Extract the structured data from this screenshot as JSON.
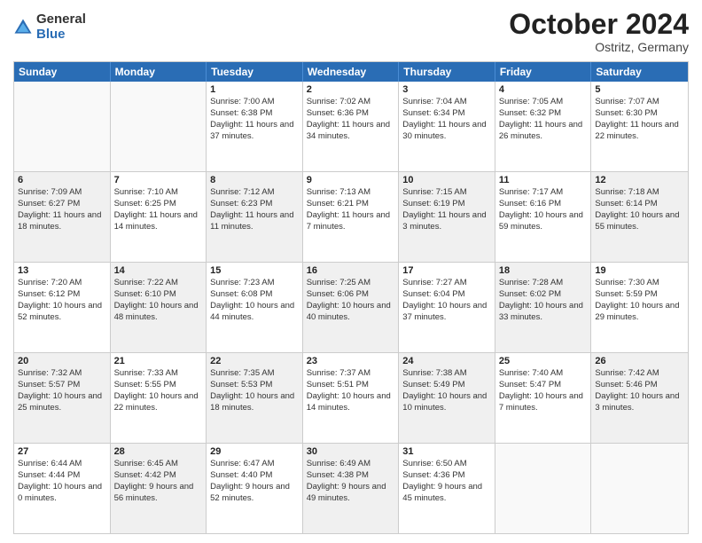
{
  "header": {
    "logo": {
      "general": "General",
      "blue": "Blue"
    },
    "title": "October 2024",
    "location": "Ostritz, Germany"
  },
  "days_of_week": [
    "Sunday",
    "Monday",
    "Tuesday",
    "Wednesday",
    "Thursday",
    "Friday",
    "Saturday"
  ],
  "weeks": [
    [
      {
        "day": "",
        "sunrise": "",
        "sunset": "",
        "daylight": "",
        "empty": true
      },
      {
        "day": "",
        "sunrise": "",
        "sunset": "",
        "daylight": "",
        "empty": true
      },
      {
        "day": "1",
        "sunrise": "Sunrise: 7:00 AM",
        "sunset": "Sunset: 6:38 PM",
        "daylight": "Daylight: 11 hours and 37 minutes.",
        "empty": false
      },
      {
        "day": "2",
        "sunrise": "Sunrise: 7:02 AM",
        "sunset": "Sunset: 6:36 PM",
        "daylight": "Daylight: 11 hours and 34 minutes.",
        "empty": false
      },
      {
        "day": "3",
        "sunrise": "Sunrise: 7:04 AM",
        "sunset": "Sunset: 6:34 PM",
        "daylight": "Daylight: 11 hours and 30 minutes.",
        "empty": false
      },
      {
        "day": "4",
        "sunrise": "Sunrise: 7:05 AM",
        "sunset": "Sunset: 6:32 PM",
        "daylight": "Daylight: 11 hours and 26 minutes.",
        "empty": false
      },
      {
        "day": "5",
        "sunrise": "Sunrise: 7:07 AM",
        "sunset": "Sunset: 6:30 PM",
        "daylight": "Daylight: 11 hours and 22 minutes.",
        "empty": false
      }
    ],
    [
      {
        "day": "6",
        "sunrise": "Sunrise: 7:09 AM",
        "sunset": "Sunset: 6:27 PM",
        "daylight": "Daylight: 11 hours and 18 minutes.",
        "empty": false,
        "shaded": true
      },
      {
        "day": "7",
        "sunrise": "Sunrise: 7:10 AM",
        "sunset": "Sunset: 6:25 PM",
        "daylight": "Daylight: 11 hours and 14 minutes.",
        "empty": false
      },
      {
        "day": "8",
        "sunrise": "Sunrise: 7:12 AM",
        "sunset": "Sunset: 6:23 PM",
        "daylight": "Daylight: 11 hours and 11 minutes.",
        "empty": false,
        "shaded": true
      },
      {
        "day": "9",
        "sunrise": "Sunrise: 7:13 AM",
        "sunset": "Sunset: 6:21 PM",
        "daylight": "Daylight: 11 hours and 7 minutes.",
        "empty": false
      },
      {
        "day": "10",
        "sunrise": "Sunrise: 7:15 AM",
        "sunset": "Sunset: 6:19 PM",
        "daylight": "Daylight: 11 hours and 3 minutes.",
        "empty": false,
        "shaded": true
      },
      {
        "day": "11",
        "sunrise": "Sunrise: 7:17 AM",
        "sunset": "Sunset: 6:16 PM",
        "daylight": "Daylight: 10 hours and 59 minutes.",
        "empty": false
      },
      {
        "day": "12",
        "sunrise": "Sunrise: 7:18 AM",
        "sunset": "Sunset: 6:14 PM",
        "daylight": "Daylight: 10 hours and 55 minutes.",
        "empty": false,
        "shaded": true
      }
    ],
    [
      {
        "day": "13",
        "sunrise": "Sunrise: 7:20 AM",
        "sunset": "Sunset: 6:12 PM",
        "daylight": "Daylight: 10 hours and 52 minutes.",
        "empty": false
      },
      {
        "day": "14",
        "sunrise": "Sunrise: 7:22 AM",
        "sunset": "Sunset: 6:10 PM",
        "daylight": "Daylight: 10 hours and 48 minutes.",
        "empty": false,
        "shaded": true
      },
      {
        "day": "15",
        "sunrise": "Sunrise: 7:23 AM",
        "sunset": "Sunset: 6:08 PM",
        "daylight": "Daylight: 10 hours and 44 minutes.",
        "empty": false
      },
      {
        "day": "16",
        "sunrise": "Sunrise: 7:25 AM",
        "sunset": "Sunset: 6:06 PM",
        "daylight": "Daylight: 10 hours and 40 minutes.",
        "empty": false,
        "shaded": true
      },
      {
        "day": "17",
        "sunrise": "Sunrise: 7:27 AM",
        "sunset": "Sunset: 6:04 PM",
        "daylight": "Daylight: 10 hours and 37 minutes.",
        "empty": false
      },
      {
        "day": "18",
        "sunrise": "Sunrise: 7:28 AM",
        "sunset": "Sunset: 6:02 PM",
        "daylight": "Daylight: 10 hours and 33 minutes.",
        "empty": false,
        "shaded": true
      },
      {
        "day": "19",
        "sunrise": "Sunrise: 7:30 AM",
        "sunset": "Sunset: 5:59 PM",
        "daylight": "Daylight: 10 hours and 29 minutes.",
        "empty": false
      }
    ],
    [
      {
        "day": "20",
        "sunrise": "Sunrise: 7:32 AM",
        "sunset": "Sunset: 5:57 PM",
        "daylight": "Daylight: 10 hours and 25 minutes.",
        "empty": false,
        "shaded": true
      },
      {
        "day": "21",
        "sunrise": "Sunrise: 7:33 AM",
        "sunset": "Sunset: 5:55 PM",
        "daylight": "Daylight: 10 hours and 22 minutes.",
        "empty": false
      },
      {
        "day": "22",
        "sunrise": "Sunrise: 7:35 AM",
        "sunset": "Sunset: 5:53 PM",
        "daylight": "Daylight: 10 hours and 18 minutes.",
        "empty": false,
        "shaded": true
      },
      {
        "day": "23",
        "sunrise": "Sunrise: 7:37 AM",
        "sunset": "Sunset: 5:51 PM",
        "daylight": "Daylight: 10 hours and 14 minutes.",
        "empty": false
      },
      {
        "day": "24",
        "sunrise": "Sunrise: 7:38 AM",
        "sunset": "Sunset: 5:49 PM",
        "daylight": "Daylight: 10 hours and 10 minutes.",
        "empty": false,
        "shaded": true
      },
      {
        "day": "25",
        "sunrise": "Sunrise: 7:40 AM",
        "sunset": "Sunset: 5:47 PM",
        "daylight": "Daylight: 10 hours and 7 minutes.",
        "empty": false
      },
      {
        "day": "26",
        "sunrise": "Sunrise: 7:42 AM",
        "sunset": "Sunset: 5:46 PM",
        "daylight": "Daylight: 10 hours and 3 minutes.",
        "empty": false,
        "shaded": true
      }
    ],
    [
      {
        "day": "27",
        "sunrise": "Sunrise: 6:44 AM",
        "sunset": "Sunset: 4:44 PM",
        "daylight": "Daylight: 10 hours and 0 minutes.",
        "empty": false
      },
      {
        "day": "28",
        "sunrise": "Sunrise: 6:45 AM",
        "sunset": "Sunset: 4:42 PM",
        "daylight": "Daylight: 9 hours and 56 minutes.",
        "empty": false,
        "shaded": true
      },
      {
        "day": "29",
        "sunrise": "Sunrise: 6:47 AM",
        "sunset": "Sunset: 4:40 PM",
        "daylight": "Daylight: 9 hours and 52 minutes.",
        "empty": false
      },
      {
        "day": "30",
        "sunrise": "Sunrise: 6:49 AM",
        "sunset": "Sunset: 4:38 PM",
        "daylight": "Daylight: 9 hours and 49 minutes.",
        "empty": false,
        "shaded": true
      },
      {
        "day": "31",
        "sunrise": "Sunrise: 6:50 AM",
        "sunset": "Sunset: 4:36 PM",
        "daylight": "Daylight: 9 hours and 45 minutes.",
        "empty": false
      },
      {
        "day": "",
        "sunrise": "",
        "sunset": "",
        "daylight": "",
        "empty": true
      },
      {
        "day": "",
        "sunrise": "",
        "sunset": "",
        "daylight": "",
        "empty": true
      }
    ]
  ]
}
